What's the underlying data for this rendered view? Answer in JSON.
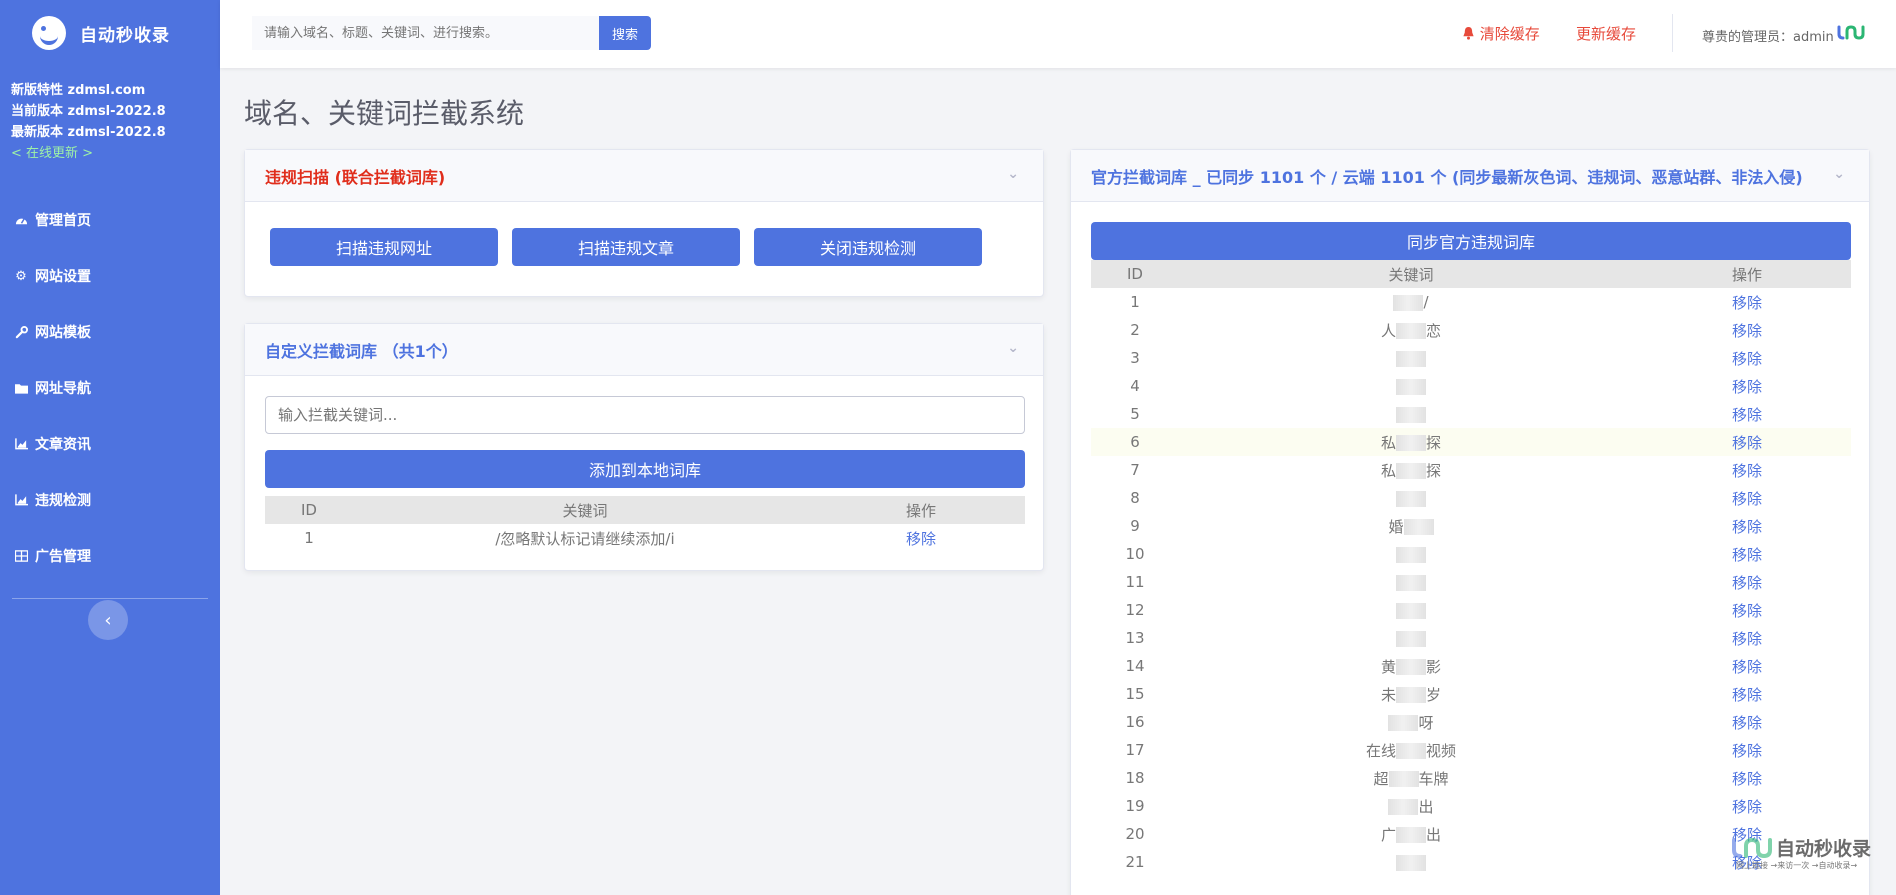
{
  "brand": {
    "name": "自动秒收录"
  },
  "version": {
    "line1": "新版特性 zdmsl.com",
    "line2": "当前版本 zdmsl-2022.8",
    "line3": "最新版本 zdmsl-2022.8",
    "update": "< 在线更新 >"
  },
  "nav": {
    "items": [
      {
        "label": "管理首页",
        "icon": "dashboard-icon"
      },
      {
        "label": "网站设置",
        "icon": "gear-icon"
      },
      {
        "label": "网站模板",
        "icon": "wrench-icon"
      },
      {
        "label": "网址导航",
        "icon": "folder-icon"
      },
      {
        "label": "文章资讯",
        "icon": "chart-icon"
      },
      {
        "label": "违规检测",
        "icon": "chart-icon"
      },
      {
        "label": "广告管理",
        "icon": "grid-icon"
      }
    ]
  },
  "topbar": {
    "search_placeholder": "请输入域名、标题、关键词、进行搜索。",
    "search_button": "搜索",
    "clear_cache": "清除缓存",
    "update_cache": "更新缓存",
    "admin": "尊贵的管理员：admin"
  },
  "page_title": "域名、关键词拦截系统",
  "scan": {
    "title": "违规扫描 (联合拦截词库)",
    "buttons": [
      "扫描违规网址",
      "扫描违规文章",
      "关闭违规检测"
    ]
  },
  "custom": {
    "title": "自定义拦截词库 （共1个）",
    "input_placeholder": "输入拦截关键词...",
    "add_button": "添加到本地词库",
    "columns": [
      "ID",
      "关键词",
      "操作"
    ],
    "rows": [
      {
        "id": "1",
        "keyword": "/忽略默认标记请继续添加/i",
        "action": "移除"
      }
    ]
  },
  "official": {
    "title": "官方拦截词库 _ 已同步 1101 个 / 云端 1101 个 (同步最新灰色词、违规词、恶意站群、非法入侵)",
    "sync_button": "同步官方违规词库",
    "columns": [
      "ID",
      "关键词",
      "操作"
    ],
    "rows": [
      {
        "id": "1",
        "pre": "",
        "post": "/",
        "action": "移除"
      },
      {
        "id": "2",
        "pre": "人",
        "post": "恋",
        "action": "移除"
      },
      {
        "id": "3",
        "pre": "",
        "post": "",
        "action": "移除"
      },
      {
        "id": "4",
        "pre": "",
        "post": "",
        "action": "移除"
      },
      {
        "id": "5",
        "pre": "",
        "post": "",
        "action": "移除"
      },
      {
        "id": "6",
        "pre": "私",
        "post": "探",
        "action": "移除"
      },
      {
        "id": "7",
        "pre": "私",
        "post": "探",
        "action": "移除"
      },
      {
        "id": "8",
        "pre": "",
        "post": "",
        "action": "移除"
      },
      {
        "id": "9",
        "pre": "婚",
        "post": "",
        "action": "移除"
      },
      {
        "id": "10",
        "pre": "",
        "post": "",
        "action": "移除"
      },
      {
        "id": "11",
        "pre": "",
        "post": "",
        "action": "移除"
      },
      {
        "id": "12",
        "pre": "",
        "post": "",
        "action": "移除"
      },
      {
        "id": "13",
        "pre": "",
        "post": "",
        "action": "移除"
      },
      {
        "id": "14",
        "pre": "黄",
        "post": "影",
        "action": "移除"
      },
      {
        "id": "15",
        "pre": "未",
        "post": "岁",
        "action": "移除"
      },
      {
        "id": "16",
        "pre": "",
        "post": "呀",
        "action": "移除"
      },
      {
        "id": "17",
        "pre": "在线",
        "post": "视频",
        "action": "移除"
      },
      {
        "id": "18",
        "pre": "超",
        "post": "车牌",
        "action": "移除"
      },
      {
        "id": "19",
        "pre": "",
        "post": "出",
        "action": "移除"
      },
      {
        "id": "20",
        "pre": "广",
        "post": "出",
        "action": "移除"
      },
      {
        "id": "21",
        "pre": "",
        "post": "",
        "action": "移除"
      }
    ],
    "highlight_row": 6
  },
  "watermark": {
    "text": "自动秒收录",
    "sub": "网上链接 →来访一次 →自动收录→"
  }
}
